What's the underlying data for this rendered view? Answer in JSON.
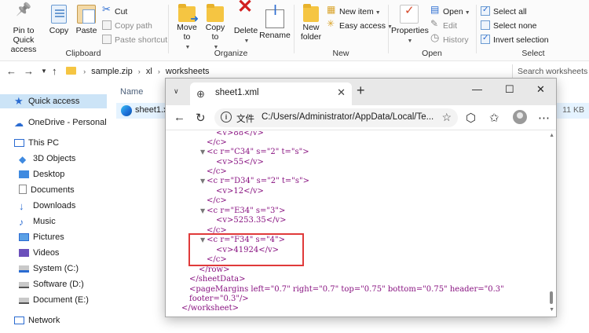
{
  "ribbon": {
    "clipboard": {
      "pin_label": "Pin to Quick access",
      "copy_label": "Copy",
      "paste_label": "Paste",
      "cut_label": "Cut",
      "copy_path_label": "Copy path",
      "paste_shortcut_label": "Paste shortcut",
      "group_label": "Clipboard"
    },
    "organize": {
      "move_to_label": "Move to",
      "copy_to_label": "Copy to",
      "delete_label": "Delete",
      "rename_label": "Rename",
      "group_label": "Organize"
    },
    "new": {
      "new_folder_label": "New folder",
      "new_item_label": "New item",
      "easy_access_label": "Easy access",
      "group_label": "New"
    },
    "open": {
      "properties_label": "Properties",
      "open_label": "Open",
      "edit_label": "Edit",
      "history_label": "History",
      "group_label": "Open"
    },
    "select": {
      "select_all_label": "Select all",
      "select_none_label": "Select none",
      "invert_selection_label": "Invert selection",
      "group_label": "Select"
    }
  },
  "address": {
    "path": [
      "sample.zip",
      "xl",
      "worksheets"
    ],
    "search_placeholder": "Search worksheets"
  },
  "nav": {
    "items": [
      {
        "label": "Quick access",
        "icon": "star-icon"
      },
      {
        "label": "OneDrive - Personal",
        "icon": "cloud-icon"
      },
      {
        "label": "This PC",
        "icon": "monitor-icon"
      },
      {
        "label": "3D Objects",
        "icon": "cube-icon"
      },
      {
        "label": "Desktop",
        "icon": "desktop-icon"
      },
      {
        "label": "Documents",
        "icon": "document-icon"
      },
      {
        "label": "Downloads",
        "icon": "download-icon"
      },
      {
        "label": "Music",
        "icon": "music-icon"
      },
      {
        "label": "Pictures",
        "icon": "picture-icon"
      },
      {
        "label": "Videos",
        "icon": "video-icon"
      },
      {
        "label": "System (C:)",
        "icon": "drive-icon"
      },
      {
        "label": "Software (D:)",
        "icon": "drive-icon"
      },
      {
        "label": "Document (E:)",
        "icon": "drive-icon"
      },
      {
        "label": "Network",
        "icon": "network-icon"
      }
    ]
  },
  "filelist": {
    "column_name": "Name",
    "file_name": "sheet1.xml",
    "file_size": "11 KB"
  },
  "edge": {
    "tab_title": "sheet1.xml",
    "scheme_label": "文件",
    "url": "C:/Users/Administrator/AppData/Local/Te..."
  },
  "xml": {
    "lines": [
      {
        "t": "<v>88</v>"
      },
      {
        "t": "</c>"
      },
      {
        "t": "<c r=\"C34\" s=\"2\" t=\"s\">"
      },
      {
        "t": "<v>55</v>"
      },
      {
        "t": "</c>"
      },
      {
        "t": "<c r=\"D34\" s=\"2\" t=\"s\">"
      },
      {
        "t": "<v>12</v>"
      },
      {
        "t": "</c>"
      },
      {
        "t": "<c r=\"E34\" s=\"3\">"
      },
      {
        "t": "<v>5253.35</v>"
      },
      {
        "t": "</c>"
      },
      {
        "t": "<c r=\"F34\" s=\"4\">"
      },
      {
        "t": "<v>41924</v>"
      },
      {
        "t": "</c>"
      },
      {
        "t": "</row>"
      },
      {
        "t": "</sheetData>"
      },
      {
        "t": "<pageMargins left=\"0.7\" right=\"0.7\" top=\"0.75\" bottom=\"0.75\" header=\"0.3\""
      },
      {
        "t": "footer=\"0.3\"/>"
      },
      {
        "t": "</worksheet>"
      }
    ]
  }
}
